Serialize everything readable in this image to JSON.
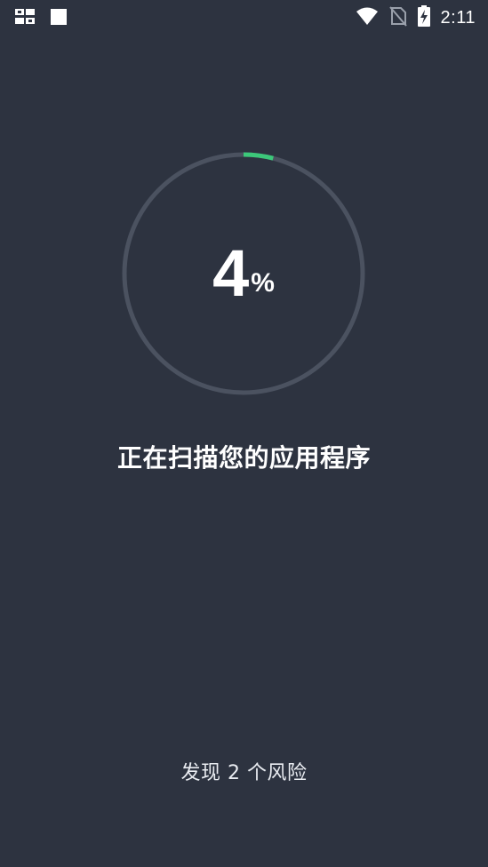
{
  "status_bar": {
    "time": "2:11",
    "icons": [
      "notification-app-icon",
      "notification-square-icon",
      "wifi-icon",
      "no-sim-icon",
      "battery-charging-icon"
    ]
  },
  "scan": {
    "progress_value": "4",
    "progress_unit": "%",
    "progress_fraction": 0.04,
    "title": "正在扫描您的应用程序",
    "risk_text": "发现 2 个风险"
  },
  "colors": {
    "background": "#2d3340",
    "ring_track": "#4b5260",
    "ring_progress": "#3cc87a",
    "text": "#ffffff"
  }
}
